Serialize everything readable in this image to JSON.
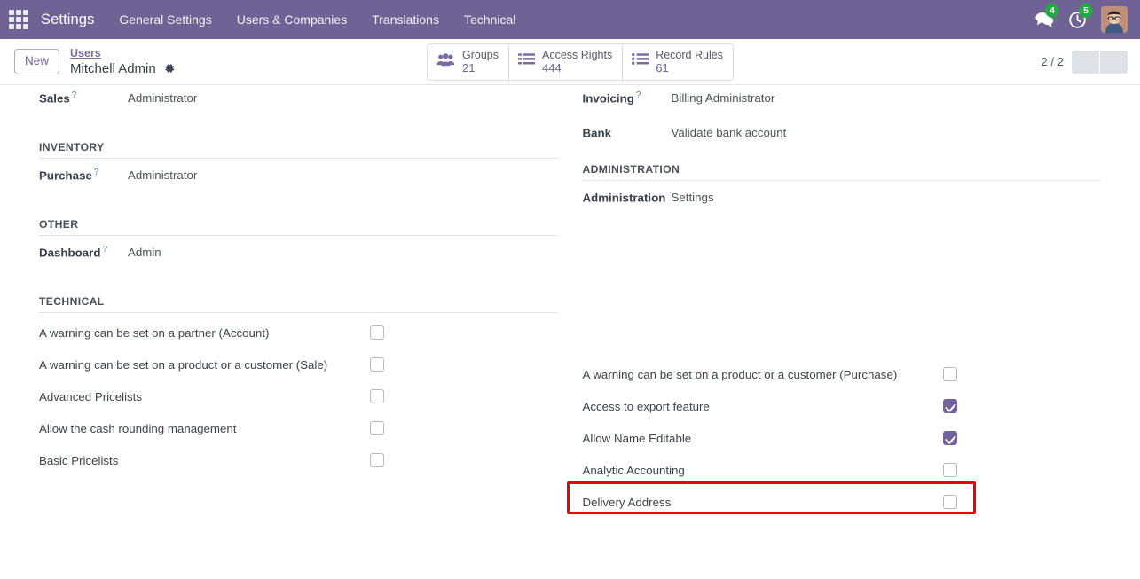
{
  "navbar": {
    "apps_icon": "apps-grid-icon",
    "brand": "Settings",
    "menu": [
      {
        "label": "General Settings"
      },
      {
        "label": "Users & Companies"
      },
      {
        "label": "Translations"
      },
      {
        "label": "Technical"
      }
    ],
    "messages_icon": "messages-icon",
    "messages_count": "4",
    "activities_icon": "clock-activity-icon",
    "activities_count": "5",
    "avatar": "user-avatar",
    "background_color": "#6f6295",
    "badge_color": "#28a745"
  },
  "control_panel": {
    "new_button": "New",
    "breadcrumb_parent": "Users",
    "breadcrumb_current": "Mitchell Admin",
    "gear_icon": "gear-icon",
    "stat_buttons": [
      {
        "icon": "users-group-icon",
        "label": "Groups",
        "value": "21"
      },
      {
        "icon": "list-icon",
        "label": "Access Rights",
        "value": "444"
      },
      {
        "icon": "list-dot-icon",
        "label": "Record Rules",
        "value": "61"
      }
    ],
    "pager": {
      "count": "2 / 2",
      "previous_icon": "chevron-left-icon",
      "next_icon": "chevron-right-icon"
    }
  },
  "form": {
    "top_fields": {
      "left": [
        {
          "label": "Sales",
          "help": "?",
          "value": "Administrator"
        }
      ],
      "right": [
        {
          "label": "Invoicing",
          "help": "?",
          "value": "Billing Administrator"
        },
        {
          "label": "Bank",
          "help": "",
          "value": "Validate bank account"
        }
      ]
    },
    "sections": {
      "inventory": {
        "title": "INVENTORY",
        "fields": [
          {
            "label": "Purchase",
            "help": "?",
            "value": "Administrator"
          }
        ]
      },
      "administration": {
        "title": "ADMINISTRATION",
        "fields": [
          {
            "label": "Administration",
            "help": "",
            "value": "Settings"
          }
        ]
      },
      "other": {
        "title": "OTHER",
        "fields": [
          {
            "label": "Dashboard",
            "help": "?",
            "value": "Admin"
          }
        ]
      },
      "technical": {
        "title": "TECHNICAL",
        "left_checkboxes": [
          {
            "label": "A warning can be set on a partner (Account)",
            "checked": false
          },
          {
            "label": "A warning can be set on a product or a customer (Sale)",
            "checked": false
          },
          {
            "label": "Advanced Pricelists",
            "checked": false
          },
          {
            "label": "Allow the cash rounding management",
            "checked": false
          },
          {
            "label": "Basic Pricelists",
            "checked": false
          }
        ],
        "right_checkboxes": [
          {
            "label": "A warning can be set on a product or a customer (Purchase)",
            "checked": false
          },
          {
            "label": "Access to export feature",
            "checked": true
          },
          {
            "label": "Allow Name Editable",
            "checked": true,
            "highlighted": true
          },
          {
            "label": "Analytic Accounting",
            "checked": false
          },
          {
            "label": "Delivery Address",
            "checked": false
          }
        ]
      }
    }
  },
  "highlight": {
    "color": "#ef0000",
    "target": "Allow Name Editable"
  }
}
